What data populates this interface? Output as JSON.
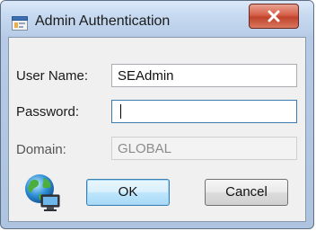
{
  "window": {
    "title": "Admin Authentication",
    "icons": {
      "app": "app-icon",
      "close": "close-icon"
    }
  },
  "form": {
    "username": {
      "label": "User Name:",
      "value": "SEAdmin"
    },
    "password": {
      "label": "Password:",
      "value": ""
    },
    "domain": {
      "label": "Domain:",
      "value": "GLOBAL"
    }
  },
  "buttons": {
    "ok": "OK",
    "cancel": "Cancel"
  },
  "icons": {
    "network": "network-globe-icon"
  },
  "colors": {
    "title_bar": "#c6d9f0",
    "close": "#c0432c",
    "default_button": "#bee6fd"
  }
}
